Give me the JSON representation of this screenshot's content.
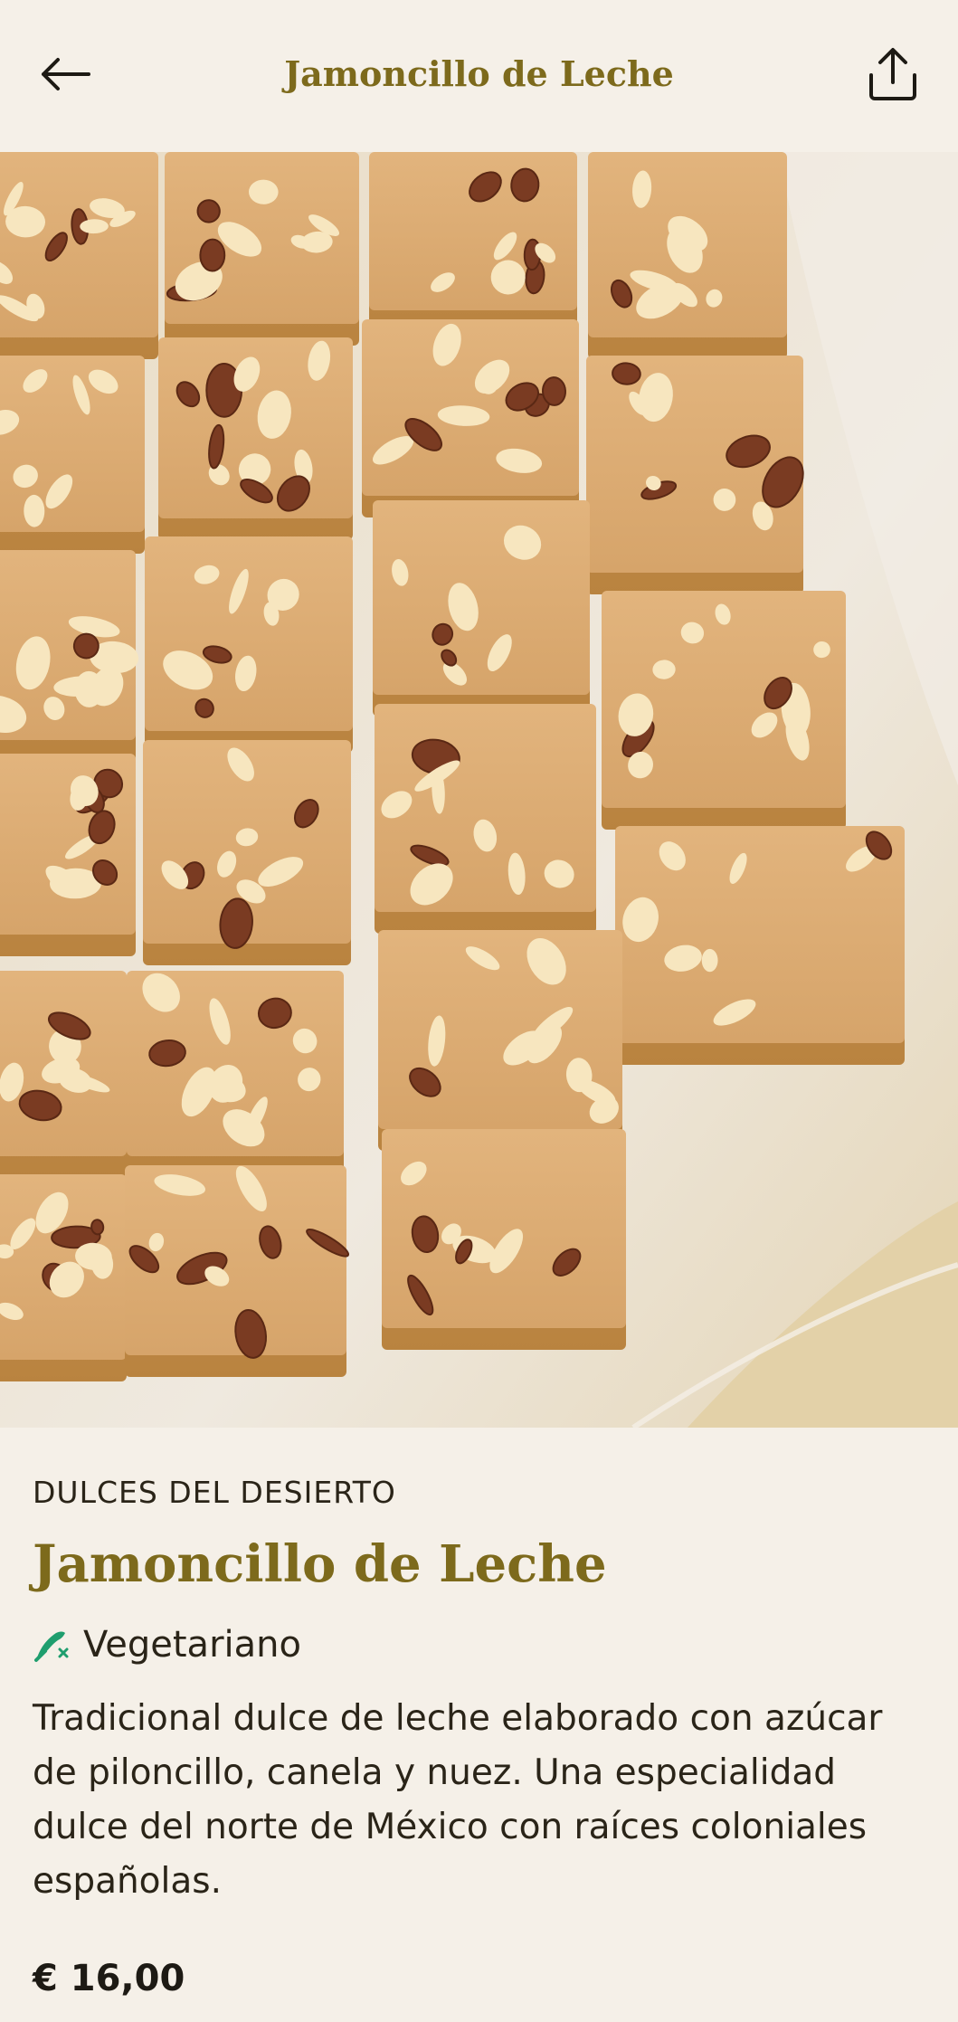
{
  "header": {
    "title": "Jamoncillo de Leche",
    "back_icon": "arrow-left-icon",
    "share_icon": "share-icon"
  },
  "product": {
    "brand": "DULCES DEL DESIERTO",
    "name": "Jamoncillo de Leche",
    "diet_label": "Vegetariano",
    "diet_icon": "vegetarian-leaf-icon",
    "description": "Tradicional dulce de leche elaborado con azúcar de piloncillo, canela y nuez. Una especialidad dulce del norte de México con raíces coloniales españolas.",
    "price": "€ 16,00"
  },
  "colors": {
    "background": "#f5f0e8",
    "accent": "#7d6a1c",
    "text": "#2a2418",
    "diet_icon": "#1f9e6e"
  }
}
